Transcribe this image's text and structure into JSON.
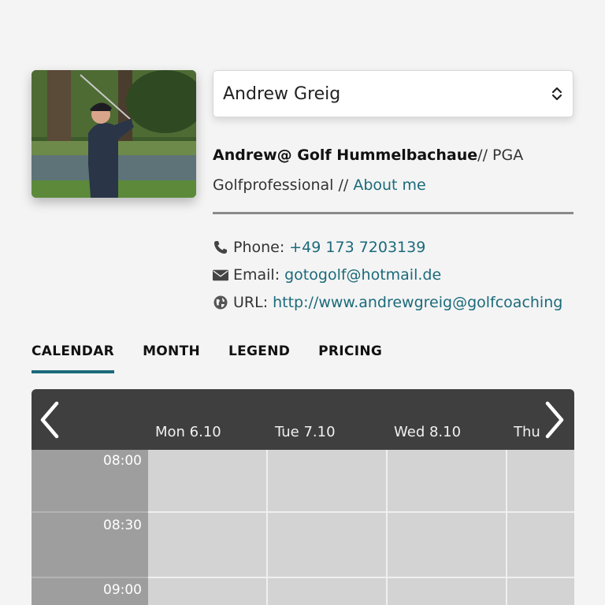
{
  "profile": {
    "name": "Andrew Greig",
    "bio_bold": "Andrew@ Golf Hummelbachaue",
    "bio_rest": "// PGA Golfprofessional //",
    "about_link": "About me"
  },
  "contacts": [
    {
      "icon": "phone-icon",
      "label": "Phone:",
      "value": "+49 173 7203139"
    },
    {
      "icon": "envelope-icon",
      "label": "Email:",
      "value": "gotogolf@hotmail.de"
    },
    {
      "icon": "globe-icon",
      "label": "URL:",
      "value": "http://www.andrewgreig@golfcoaching"
    }
  ],
  "tabs": [
    {
      "label": "CALENDAR",
      "active": true
    },
    {
      "label": "MONTH",
      "active": false
    },
    {
      "label": "LEGEND",
      "active": false
    },
    {
      "label": "PRICING",
      "active": false
    }
  ],
  "calendar": {
    "days": [
      "Mon 6.10",
      "Tue 7.10",
      "Wed 8.10",
      "Thu"
    ],
    "times": [
      "08:00",
      "08:30",
      "09:00"
    ]
  },
  "colors": {
    "accent": "#1b6a7a",
    "header_bg": "#3f3f3f",
    "time_col": "#9e9e9e",
    "slot_bg": "#d3d3d3"
  }
}
